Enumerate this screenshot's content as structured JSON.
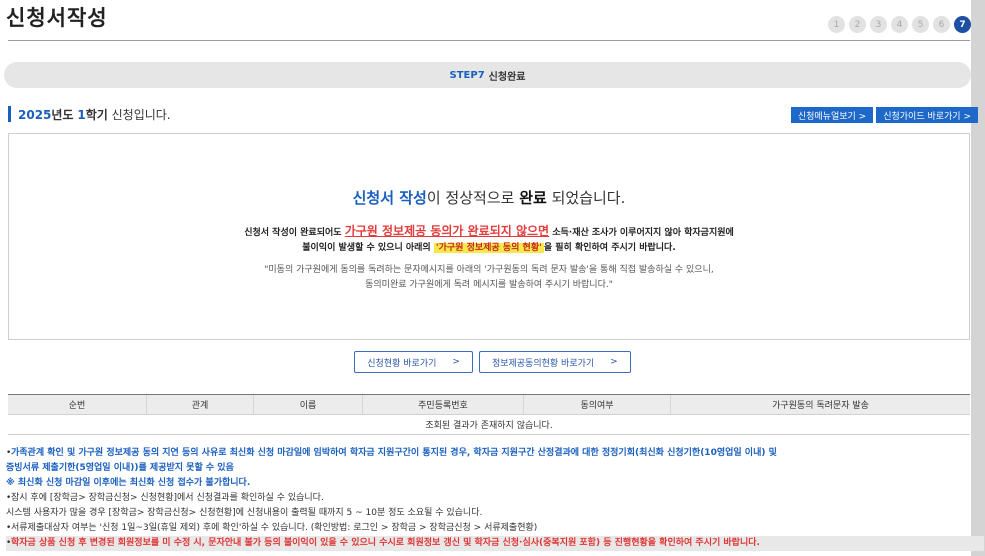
{
  "header": {
    "title": "신청서작성",
    "steps": [
      "1",
      "2",
      "3",
      "4",
      "5",
      "6",
      "7"
    ],
    "active_step": "7"
  },
  "banner": {
    "step_no": "STEP7",
    "label": "신청완료"
  },
  "semester": {
    "year": "2025",
    "year_suffix": "년도",
    "term": "1",
    "term_suffix": "학기",
    "rest": "신청입니다.",
    "menu_link": "신청메뉴얼보기 >",
    "guide_link": "신청가이드 바로가기 >"
  },
  "result": {
    "done_blue": "신청서 작성",
    "done_mid": "이 정상적으로",
    "done_bold": "완료",
    "done_end": "되었습니다.",
    "warn1_pre": "신청서 작성이 완료되어도",
    "warn1_red": "가구원 정보제공 동의가 완료되지 않으면",
    "warn1_post": "소득·재산 조사가 이루어지지 않아 학자금지원에",
    "warn2_pre": "불이익이 발생할 수 있으니 아래의",
    "warn2_hl": "'가구원 정보제공 동의 현황'",
    "warn2_post": "을 필히 확인하여 주시기 바랍니다.",
    "note1": "\"미동의 가구원에게 동의를 독려하는 문자메시지를 아래의 '가구원동의 독려 문자 발송'을 통해 직접 발송하실 수 있으니,",
    "note2": "동의미완료 가구원에게 독려 메시지를 발송하여 주시기 바랍니다.\""
  },
  "buttons": {
    "status_label": "신청현황 바로가기",
    "consent_label": "정보제공동의현황 바로가기",
    "arrow": ">"
  },
  "table": {
    "columns": [
      "순번",
      "관계",
      "이름",
      "주민등록번호",
      "동의여부",
      "가구원동의 독려문자 발송"
    ],
    "empty_message": "조회된 결과가 존재하지 않습니다."
  },
  "notices": {
    "bullet": "•",
    "n1": "가족관계 확인 및 가구원 정보제공 동의 지연 등의 사유로 최신화 신청 마감일에 임박하여 학자금 지원구간이 통지된 경우, 학자금 지원구간 산정결과에 대한 정정기회(최신화 신청기한(10영업일 이내) 및",
    "n1b": "증빙서류 제출기한(5영업일 이내))를 제공받지 못할 수 있음",
    "n1c": "※ 최신화 신청 마감일 이후에는 최신화 신청 접수가 불가합니다.",
    "n2": "잠시 후에 [장학금> 장학금신청> 신청현황]에서 신청결과를 확인하실 수 있습니다.",
    "n2b": "시스템 사용자가 많을 경우 [장학금> 장학금신청> 신청현황]에 신청내용이 출력될 때까지 5 ~ 10분 정도 소요될 수 있습니다.",
    "n3": "서류제출대상자 여부는 '신청 1일~3일(휴일 제외) 후에 확인'하실 수 있습니다. (확인방법: 로그인 > 장학금 > 장학금신청 > 서류제출현황)",
    "n4": "학자금 상품 신청 후 변경된 회원정보를 미 수정 시, 문자안내 불가 등의 불이익이 있을 수 있으니 수시로 회원정보 갱신 및 학자금 신청·심사(중복지원 포함) 등 진행현황을 확인하여 주시기 바랍니다."
  }
}
